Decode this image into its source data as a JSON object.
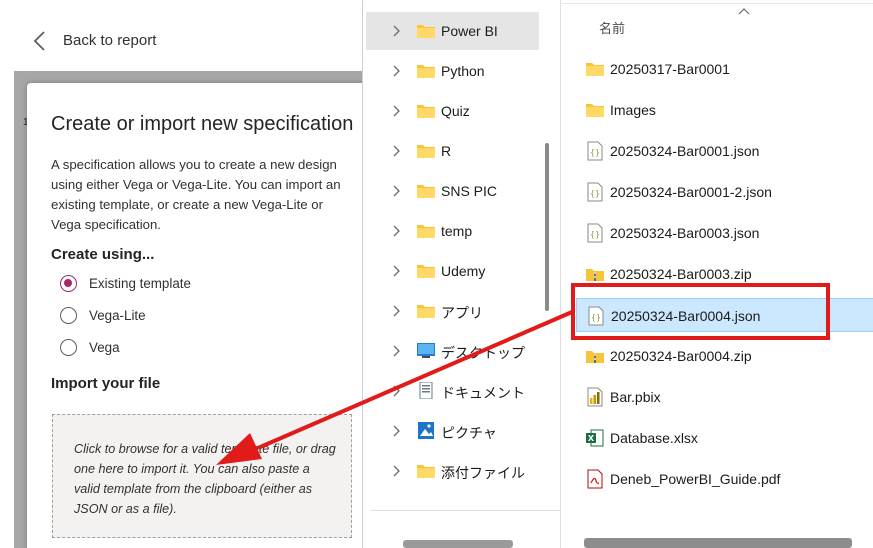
{
  "powerbi": {
    "back_label": "Back to report",
    "gutter_number": "1",
    "dialog": {
      "title": "Create or import new specification",
      "description": "A specification allows you to create a new design using either Vega or Vega-Lite. You can import an existing template, or create a new Vega-Lite or Vega specification.",
      "create_heading": "Create using...",
      "options": [
        {
          "label": "Existing template",
          "checked": true
        },
        {
          "label": "Vega-Lite",
          "checked": false
        },
        {
          "label": "Vega",
          "checked": false
        }
      ],
      "import_heading": "Import your file",
      "drop_text": "Click to browse for a valid template file, or drag one here to import it. You can also paste a valid template from the clipboard (either as JSON or as a file)."
    },
    "accent_color": "#a8276b"
  },
  "explorer": {
    "nav_items": [
      {
        "label": "Power BI",
        "icon": "folder-icon",
        "selected": true
      },
      {
        "label": "Python",
        "icon": "folder-icon"
      },
      {
        "label": "Quiz",
        "icon": "folder-icon"
      },
      {
        "label": "R",
        "icon": "folder-icon"
      },
      {
        "label": "SNS PIC",
        "icon": "folder-icon"
      },
      {
        "label": "temp",
        "icon": "folder-icon"
      },
      {
        "label": "Udemy",
        "icon": "folder-icon"
      },
      {
        "label": "アプリ",
        "icon": "folder-icon"
      },
      {
        "label": "デスクトップ",
        "icon": "desktop-icon"
      },
      {
        "label": "ドキュメント",
        "icon": "documents-icon"
      },
      {
        "label": "ピクチャ",
        "icon": "pictures-icon"
      },
      {
        "label": "添付ファイル",
        "icon": "folder-icon"
      }
    ],
    "column_header": "名前",
    "files": [
      {
        "name": "20250317-Bar0001",
        "icon": "folder-icon"
      },
      {
        "name": "Images",
        "icon": "folder-icon"
      },
      {
        "name": "20250324-Bar0001.json",
        "icon": "json-file-icon"
      },
      {
        "name": "20250324-Bar0001-2.json",
        "icon": "json-file-icon"
      },
      {
        "name": "20250324-Bar0003.json",
        "icon": "json-file-icon"
      },
      {
        "name": "20250324-Bar0003.zip",
        "icon": "zip-folder-icon"
      },
      {
        "name": "20250324-Bar0004.json",
        "icon": "json-file-icon",
        "selected": true
      },
      {
        "name": "20250324-Bar0004.zip",
        "icon": "zip-folder-icon"
      },
      {
        "name": "Bar.pbix",
        "icon": "pbix-file-icon"
      },
      {
        "name": "Database.xlsx",
        "icon": "excel-file-icon"
      },
      {
        "name": "Deneb_PowerBI_Guide.pdf",
        "icon": "pdf-file-icon"
      }
    ],
    "selection_color": "#cce8ff"
  },
  "annotation": {
    "color": "#e11a1a",
    "arrow": "red arrow from the highlighted file to the drop zone"
  }
}
